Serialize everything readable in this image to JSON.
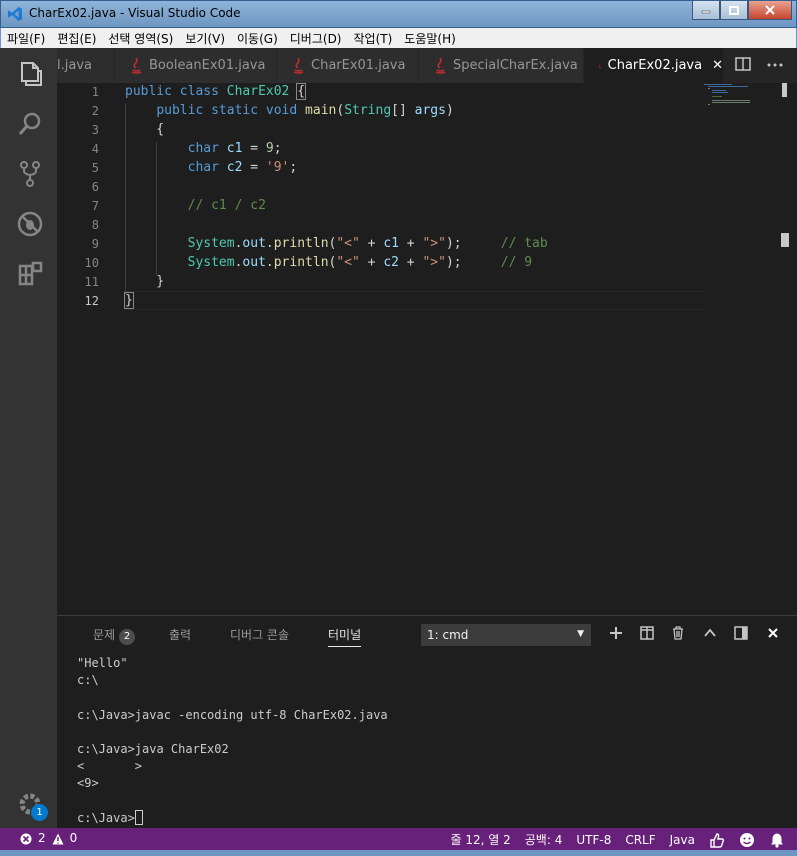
{
  "window": {
    "title": "CharEx02.java - Visual Studio Code"
  },
  "menu": [
    "파일(F)",
    "편집(E)",
    "선택 영역(S)",
    "보기(V)",
    "이동(G)",
    "디버그(D)",
    "작업(T)",
    "도움말(H)"
  ],
  "tabs": [
    {
      "label": "l.java"
    },
    {
      "label": "BooleanEx01.java"
    },
    {
      "label": "CharEx01.java"
    },
    {
      "label": "SpecialCharEx.java"
    },
    {
      "label": "CharEx02.java",
      "active": true
    }
  ],
  "editor": {
    "line_numbers": [
      "1",
      "2",
      "3",
      "4",
      "5",
      "6",
      "7",
      "8",
      "9",
      "10",
      "11",
      "12"
    ],
    "current_line": 12
  },
  "panel": {
    "tabs": [
      "문제",
      "출력",
      "디버그 콘솔",
      "터미널"
    ],
    "problem_count": "2",
    "terminal_select": "1: cmd",
    "terminal_lines": [
      "\"Hello\"",
      "c:\\",
      "",
      "c:\\Java>javac -encoding utf-8 CharEx02.java",
      "",
      "c:\\Java>java CharEx02",
      "<       >",
      "<9>",
      "",
      "c:\\Java>"
    ]
  },
  "activity": {
    "settings_badge": "1"
  },
  "status": {
    "errors": "2",
    "warnings": "0",
    "position": "줄 12, 열 2",
    "spaces": "공백: 4",
    "encoding": "UTF-8",
    "eol": "CRLF",
    "language": "Java"
  },
  "colors": {
    "statusbar": "#68217a",
    "keyword": "#569cd6",
    "type": "#4ec9b0",
    "string": "#ce9178",
    "comment": "#608b4e"
  }
}
